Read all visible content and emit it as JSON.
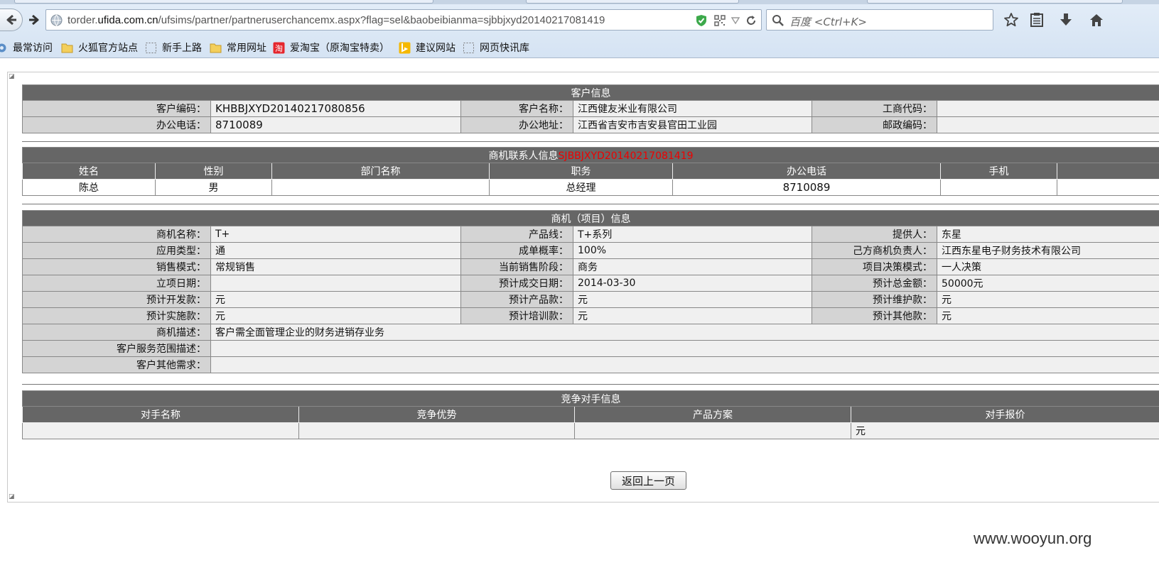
{
  "browser": {
    "url_prefix": "torder.",
    "url_domain": "ufida.com.cn",
    "url_path": "/ufsims/partner/partneruserchancemx.aspx?flag=sel&baobeibianma=sjbbjxyd20140217081419",
    "search_placeholder": "百度 <Ctrl+K>"
  },
  "bookmarks": [
    {
      "label": "最常访问",
      "icon": "gear-icon"
    },
    {
      "label": "火狐官方站点",
      "icon": "folder-icon"
    },
    {
      "label": "新手上路",
      "icon": "dotted-page-icon"
    },
    {
      "label": "常用网址",
      "icon": "folder-icon"
    },
    {
      "label": "爱淘宝（原淘宝特卖）",
      "icon": "taobao-icon"
    },
    {
      "label": "建议网站",
      "icon": "bing-icon"
    },
    {
      "label": "网页快讯库",
      "icon": "dotted-page-icon"
    }
  ],
  "customer": {
    "title": "客户信息",
    "code_label": "客户编码：",
    "code": "KHBBJXYD20140217080856",
    "name_label": "客户名称：",
    "name": "江西健友米业有限公司",
    "biz_code_label": "工商代码：",
    "biz_code": "",
    "phone_label": "办公电话：",
    "phone": "8710089",
    "address_label": "办公地址：",
    "address": "江西省吉安市吉安县官田工业园",
    "postal_label": "邮政编码：",
    "postal": ""
  },
  "contacts": {
    "title": "商机联系人信息",
    "code": "SJBBJXYD20140217081419",
    "columns": [
      "姓名",
      "性别",
      "部门名称",
      "职务",
      "办公电话",
      "手机"
    ],
    "rows": [
      [
        "陈总",
        "男",
        "",
        "总经理",
        "8710089",
        ""
      ]
    ]
  },
  "opportunity": {
    "title": "商机（项目）信息",
    "rows": [
      [
        [
          "商机名称：",
          "T+"
        ],
        [
          "产品线：",
          "T+系列"
        ],
        [
          "提供人：",
          "东星"
        ]
      ],
      [
        [
          "应用类型：",
          "通"
        ],
        [
          "成单概率：",
          "100%"
        ],
        [
          "己方商机负责人：",
          "江西东星电子财务技术有限公司"
        ]
      ],
      [
        [
          "销售模式：",
          "常规销售"
        ],
        [
          "当前销售阶段：",
          "商务"
        ],
        [
          "项目决策模式：",
          "一人决策"
        ]
      ],
      [
        [
          "立项日期：",
          ""
        ],
        [
          "预计成交日期：",
          "2014-03-30"
        ],
        [
          "预计总金额：",
          "50000元"
        ]
      ],
      [
        [
          "预计开发款：",
          "元"
        ],
        [
          "预计产品款：",
          "元"
        ],
        [
          "预计维护款：",
          "元"
        ]
      ],
      [
        [
          "预计实施款：",
          "元"
        ],
        [
          "预计培训款：",
          "元"
        ],
        [
          "预计其他款：",
          "元"
        ]
      ]
    ],
    "desc_label": "商机描述：",
    "desc": "客户需全面管理企业的财务进销存业务",
    "scope_label": "客户服务范围描述：",
    "scope": "",
    "other_label": "客户其他需求：",
    "other": ""
  },
  "competitors": {
    "title": "竞争对手信息",
    "columns": [
      "对手名称",
      "竞争优势",
      "产品方案",
      "对手报价"
    ],
    "rows": [
      [
        "",
        "",
        "",
        "元"
      ]
    ]
  },
  "back_button": "返回上一页",
  "watermark": "www.wooyun.org"
}
